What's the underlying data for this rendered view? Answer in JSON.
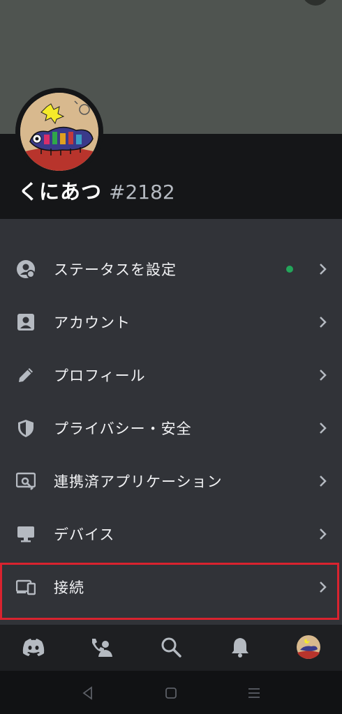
{
  "profile": {
    "name": "くにあつ",
    "discriminator": "#2182"
  },
  "menu": {
    "items": [
      {
        "label": "ステータスを設定",
        "icon": "status-icon"
      },
      {
        "label": "アカウント",
        "icon": "account-icon"
      },
      {
        "label": "プロフィール",
        "icon": "pencil-icon"
      },
      {
        "label": "プライバシー・安全",
        "icon": "shield-icon"
      },
      {
        "label": "連携済アプリケーション",
        "icon": "authorized-apps-icon"
      },
      {
        "label": "デバイス",
        "icon": "monitor-icon"
      },
      {
        "label": "接続",
        "icon": "devices-icon"
      }
    ],
    "status_color": "#23a55a"
  },
  "tabbar": {
    "tabs": [
      "discord-home-icon",
      "friends-icon",
      "search-icon",
      "bell-icon",
      "profile-avatar"
    ]
  },
  "navbar": {
    "buttons": [
      "back-icon",
      "home-icon",
      "recents-icon"
    ]
  },
  "colors": {
    "menu_bg": "#313338",
    "header_bg": "#151618",
    "banner": "#4f5450",
    "highlight": "#d9232f"
  }
}
